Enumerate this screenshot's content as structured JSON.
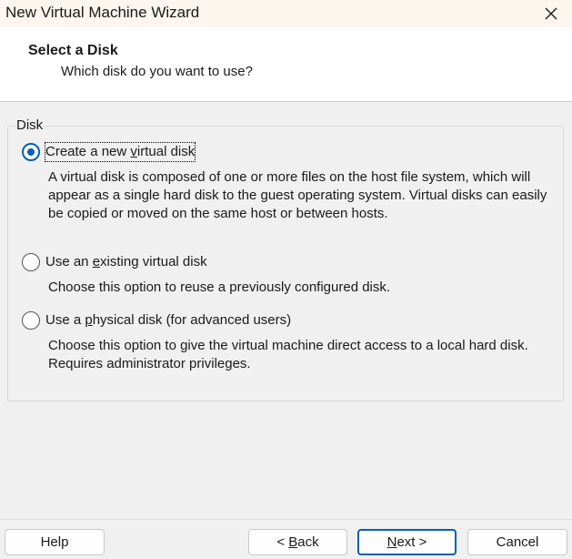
{
  "window": {
    "title": "New Virtual Machine Wizard",
    "close_icon": "close-icon"
  },
  "header": {
    "title": "Select a Disk",
    "subtitle": "Which disk do you want to use?"
  },
  "group": {
    "label": "Disk"
  },
  "options": [
    {
      "label_pre": "Create a new ",
      "label_mnemonic": "v",
      "label_post": "irtual disk",
      "selected": true,
      "description": "A virtual disk is composed of one or more files on the host file system, which will appear as a single hard disk to the guest operating system. Virtual disks can easily be copied or moved on the same host or between hosts."
    },
    {
      "label_pre": "Use an ",
      "label_mnemonic": "e",
      "label_post": "xisting virtual disk",
      "selected": false,
      "description": "Choose this option to reuse a previously configured disk."
    },
    {
      "label_pre": "Use a ",
      "label_mnemonic": "p",
      "label_post": "hysical disk (for advanced users)",
      "selected": false,
      "description": "Choose this option to give the virtual machine direct access to a local hard disk. Requires administrator privileges."
    }
  ],
  "buttons": {
    "help": "Help",
    "back_pre": "< ",
    "back_mnemonic": "B",
    "back_post": "ack",
    "next_mnemonic": "N",
    "next_post": "ext >",
    "cancel": "Cancel"
  },
  "colors": {
    "accent": "#005fb8",
    "titlebar": "#fdf6ef"
  }
}
